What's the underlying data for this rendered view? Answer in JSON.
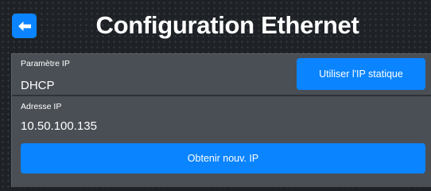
{
  "header": {
    "title": "Configuration Ethernet",
    "back_icon": "arrow-left-icon",
    "accent_color": "#0a84ff"
  },
  "ip_setting": {
    "label": "Paramètre IP",
    "value": "DHCP",
    "static_button_label": "Utiliser l'IP statique"
  },
  "ip_address": {
    "label": "Adresse IP",
    "value": "10.50.100.135"
  },
  "renew_button_label": "Obtenir nouv. IP"
}
